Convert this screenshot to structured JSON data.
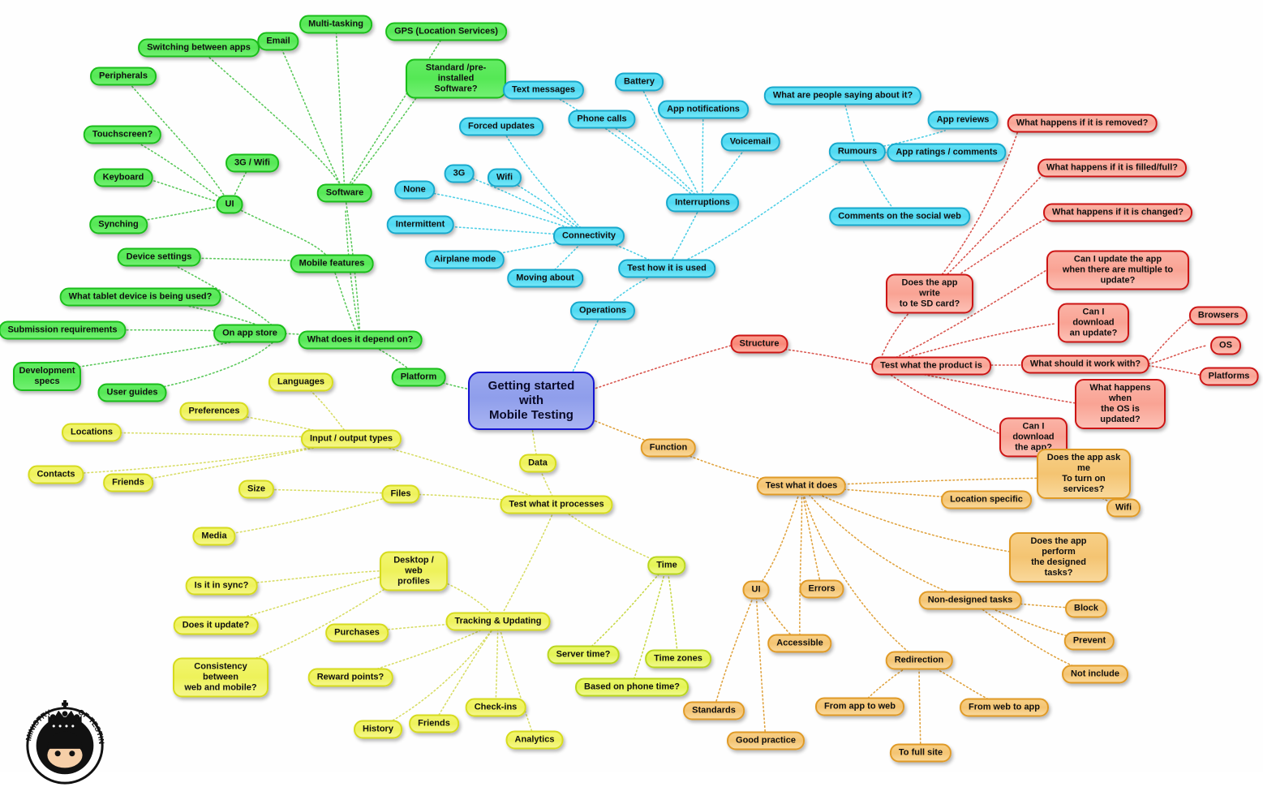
{
  "title": "Getting started with Mobile Testing",
  "logo": {
    "name": "ministry-of-testing-logo",
    "text_top": "MINISTRY",
    "text_right": "OF TESTING"
  },
  "colors": {
    "root_fill": "#9aa8ef",
    "root_border": "#1414d2",
    "green_fill": "#55e855",
    "green_border": "#19bd19",
    "cyan_fill": "#4fd9f2",
    "cyan_border": "#16a8cc",
    "red_fill": "#f9a394",
    "red_border": "#cc1414",
    "orange_fill": "#f4c472",
    "orange_border": "#e09a26",
    "yellow_fill": "#eef25a",
    "yellow_border": "#d6db1d",
    "ygreen_fill": "#e4f455",
    "ygreen_border": "#b9d61d"
  },
  "root": {
    "label": "Getting started with\nMobile Testing",
    "line1": "Getting started with",
    "line2": "Mobile Testing"
  },
  "branches": {
    "platform": {
      "label": "Platform",
      "color": "green",
      "nodes": {
        "what_depend": "What does it depend on?",
        "mobile_features": "Mobile features",
        "software": "Software",
        "ui": "UI",
        "on_app_store": "On app store",
        "peripherals": "Peripherals",
        "switching_between_apps": "Switching between apps",
        "email": "Email",
        "multi_tasking": "Multi-tasking",
        "gps": "GPS (Location Services)",
        "standard_preinstalled": "Standard /pre-installed Software?",
        "standard_preinstalled_l1": "Standard /pre-installed",
        "standard_preinstalled_l2": "Software?",
        "touchscreen": "Touchscreen?",
        "keyboard": "Keyboard",
        "synching": "Synching",
        "three_g_wifi": "3G / Wifi",
        "device_settings": "Device settings",
        "what_tablet": "What tablet device is being used?",
        "submission_requirements": "Submission requirements",
        "development_specs": "Development specs",
        "development_specs_l1": "Development",
        "development_specs_l2": "specs",
        "user_guides": "User guides"
      }
    },
    "operations": {
      "label": "Operations",
      "color": "cyan",
      "nodes": {
        "test_how_used": "Test how it is used",
        "connectivity": "Connectivity",
        "interruptions": "Interruptions",
        "rumours": "Rumours",
        "none": "None",
        "intermittent": "Intermittent",
        "airplane_mode": "Airplane mode",
        "moving_about": "Moving about",
        "three_g": "3G",
        "wifi": "Wifi",
        "forced_updates": "Forced updates",
        "text_messages": "Text messages",
        "phone_calls": "Phone calls",
        "battery": "Battery",
        "app_notifications": "App notifications",
        "voicemail": "Voicemail",
        "what_are_people_saying": "What are people saying about it?",
        "app_reviews": "App reviews",
        "app_ratings": "App ratings / comments",
        "comments_social_web": "Comments on the social web"
      }
    },
    "structure": {
      "label": "Structure",
      "color": "red",
      "nodes": {
        "test_what_product": "Test what the product is",
        "does_app_write_sd": "Does the app write to te SD card?",
        "does_app_write_sd_l1": "Does the app write",
        "does_app_write_sd_l2": "to te SD card?",
        "what_removed": "What happens if it is removed?",
        "what_filled": "What happens if it is filled/full?",
        "what_changed": "What happens if it is changed?",
        "can_update_multiple": "Can I update the app when there are multiple to update?",
        "can_update_multiple_l1": "Can I update the app",
        "can_update_multiple_l2": "when there are multiple to update?",
        "can_download_update": "Can I download an update?",
        "can_download_update_l1": "Can I download",
        "can_download_update_l2": "an update?",
        "what_should_work_with": "What  should it work with?",
        "browsers": "Browsers",
        "os": "OS",
        "platforms": "Platforms",
        "what_os_updated": "What happens when the OS is updated?",
        "what_os_updated_l1": "What happens when",
        "what_os_updated_l2": "the OS is updated?",
        "can_download_app": "Can I download the app?",
        "can_download_app_l1": "Can I download",
        "can_download_app_l2": "the app?"
      }
    },
    "function": {
      "label": "Function",
      "color": "orange",
      "nodes": {
        "test_what_it_does": "Test what it does",
        "does_app_ask": "Does the app ask me To turn on services?",
        "does_app_ask_l1": "Does the app ask me",
        "does_app_ask_l2": "To turn on services?",
        "location_specific": "Location specific",
        "wifi": "Wifi",
        "does_app_perform": "Does the app perform the designed tasks?",
        "does_app_perform_l1": "Does the app perform",
        "does_app_perform_l2": "the designed tasks?",
        "non_designed_tasks": "Non-designed tasks",
        "block": "Block",
        "prevent": "Prevent",
        "not_include": "Not include",
        "redirection": "Redirection",
        "from_app_to_web": "From app to web",
        "from_web_to_app": "From web to app",
        "to_full_site": "To full site",
        "ui": "UI",
        "errors": "Errors",
        "accessible": "Accessible",
        "standards": "Standards",
        "good_practice": "Good practice"
      }
    },
    "data": {
      "label": "Data",
      "color": "yellow",
      "nodes": {
        "test_what_processes": "Test what it processes",
        "input_output_types": "Input / output types",
        "languages": "Languages",
        "preferences": "Preferences",
        "locations": "Locations",
        "contacts": "Contacts",
        "friends": "Friends",
        "files": "Files",
        "size": "Size",
        "media": "Media",
        "tracking_updating": "Tracking & Updating",
        "desktop_web_profiles": "Desktop / web profiles",
        "desktop_web_profiles_l1": "Desktop / web",
        "desktop_web_profiles_l2": "profiles",
        "is_it_in_sync": "Is it in sync?",
        "does_it_update": "Does it update?",
        "consistency": "Consistency between web and mobile?",
        "consistency_l1": "Consistency between",
        "consistency_l2": "web and mobile?",
        "purchases": "Purchases",
        "reward_points": "Reward points?",
        "history": "History",
        "friends2": "Friends",
        "check_ins": "Check-ins",
        "analytics": "Analytics",
        "time": "Time",
        "server_time": "Server time?",
        "based_on_phone_time": "Based on phone time?",
        "time_zones": "Time zones"
      }
    }
  }
}
